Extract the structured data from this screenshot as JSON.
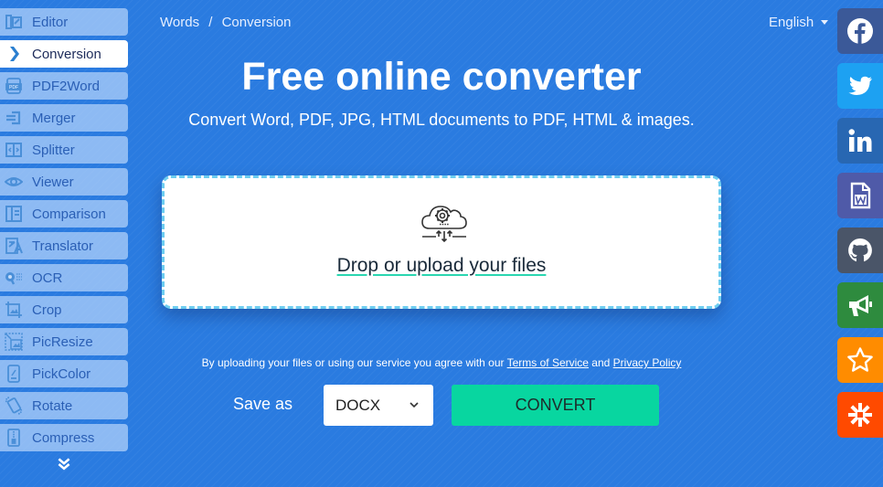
{
  "sidebar": {
    "items": [
      {
        "label": "Editor",
        "icon": "editor-icon",
        "active": false
      },
      {
        "label": "Conversion",
        "icon": "chevron-right-icon",
        "active": true
      },
      {
        "label": "PDF2Word",
        "icon": "pdf-icon",
        "active": false
      },
      {
        "label": "Merger",
        "icon": "merge-icon",
        "active": false
      },
      {
        "label": "Splitter",
        "icon": "split-icon",
        "active": false
      },
      {
        "label": "Viewer",
        "icon": "eye-icon",
        "active": false
      },
      {
        "label": "Comparison",
        "icon": "compare-icon",
        "active": false
      },
      {
        "label": "Translator",
        "icon": "translate-icon",
        "active": false
      },
      {
        "label": "OCR",
        "icon": "ocr-icon",
        "active": false
      },
      {
        "label": "Crop",
        "icon": "crop-icon",
        "active": false
      },
      {
        "label": "PicResize",
        "icon": "resize-icon",
        "active": false
      },
      {
        "label": "PickColor",
        "icon": "color-picker-icon",
        "active": false
      },
      {
        "label": "Rotate",
        "icon": "rotate-icon",
        "active": false
      },
      {
        "label": "Compress",
        "icon": "compress-icon",
        "active": false
      }
    ],
    "more_icon": "double-chevron-down-icon"
  },
  "breadcrumb": {
    "items": [
      "Words",
      "Conversion"
    ],
    "separator": "/"
  },
  "language": {
    "selected": "English"
  },
  "hero": {
    "title": "Free online converter",
    "subtitle": "Convert Word, PDF, JPG, HTML documents to PDF, HTML & images."
  },
  "dropzone": {
    "icon": "cloud-upload-gear-icon",
    "label": "Drop or upload your files"
  },
  "terms": {
    "prefix": "By uploading your files or using our service you agree with our ",
    "tos_label": "Terms of Service",
    "middle": " and ",
    "privacy_label": "Privacy Policy"
  },
  "convert_form": {
    "save_as_label": "Save as",
    "format_selected": "DOCX",
    "convert_label": "CONVERT"
  },
  "social": [
    {
      "name": "facebook",
      "color": "#3b5998"
    },
    {
      "name": "twitter",
      "color": "#1da1f2"
    },
    {
      "name": "linkedin",
      "color": "#2867b2"
    },
    {
      "name": "word-app",
      "color": "#4f5aa8"
    },
    {
      "name": "github",
      "color": "#4a5568"
    },
    {
      "name": "announcement",
      "color": "#2e8b3e"
    },
    {
      "name": "favorite",
      "color": "#ff8c00"
    },
    {
      "name": "zapier",
      "color": "#ff4a00"
    }
  ],
  "colors": {
    "background": "#2a7be0",
    "accent_green": "#08d6a0",
    "dropzone_border": "#6dcdf0"
  }
}
